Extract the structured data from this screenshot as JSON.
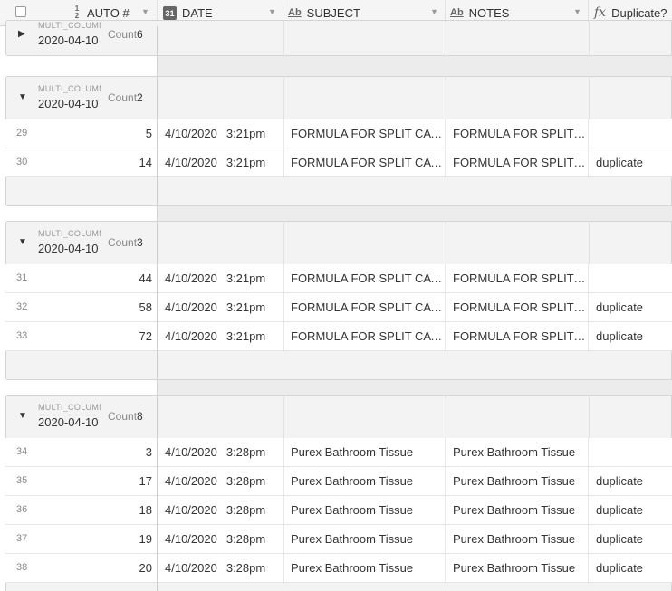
{
  "header": {
    "columns": [
      {
        "label": "AUTO #",
        "icon": "autonumber-icon"
      },
      {
        "label": "DATE",
        "icon": "date-icon"
      },
      {
        "label": "SUBJECT",
        "icon": "text-icon"
      },
      {
        "label": "NOTES",
        "icon": "text-icon"
      },
      {
        "label": "Duplicate?",
        "icon": "formula-icon"
      }
    ]
  },
  "groups": [
    {
      "field": "MULTI_COLUMN",
      "value": "2020-04-10",
      "count_label": "Count",
      "count": "6",
      "collapsed": true,
      "rows": []
    },
    {
      "field": "MULTI_COLUMN",
      "value": "2020-04-10",
      "count_label": "Count",
      "count": "2",
      "collapsed": false,
      "rows": [
        {
          "num": "29",
          "auto": "5",
          "date": "4/10/2020",
          "time": "3:21pm",
          "subject": "FORMULA FOR SPLIT CATALOG",
          "notes": "FORMULA FOR SPLIT CATALOG",
          "dup": ""
        },
        {
          "num": "30",
          "auto": "14",
          "date": "4/10/2020",
          "time": "3:21pm",
          "subject": "FORMULA FOR SPLIT CATALOG",
          "notes": "FORMULA FOR SPLIT CATALOG",
          "dup": "duplicate"
        }
      ]
    },
    {
      "field": "MULTI_COLUMN",
      "value": "2020-04-10",
      "count_label": "Count",
      "count": "3",
      "collapsed": false,
      "rows": [
        {
          "num": "31",
          "auto": "44",
          "date": "4/10/2020",
          "time": "3:21pm",
          "subject": "FORMULA FOR SPLIT CATALOG",
          "notes": "FORMULA FOR SPLIT CATALOG",
          "dup": ""
        },
        {
          "num": "32",
          "auto": "58",
          "date": "4/10/2020",
          "time": "3:21pm",
          "subject": "FORMULA FOR SPLIT CATALOG",
          "notes": "FORMULA FOR SPLIT CATALOG",
          "dup": "duplicate"
        },
        {
          "num": "33",
          "auto": "72",
          "date": "4/10/2020",
          "time": "3:21pm",
          "subject": "FORMULA FOR SPLIT CATALOG",
          "notes": "FORMULA FOR SPLIT CATALOG",
          "dup": "duplicate"
        }
      ]
    },
    {
      "field": "MULTI_COLUMN",
      "value": "2020-04-10",
      "count_label": "Count",
      "count": "8",
      "collapsed": false,
      "rows": [
        {
          "num": "34",
          "auto": "3",
          "date": "4/10/2020",
          "time": "3:28pm",
          "subject": "Purex Bathroom Tissue",
          "notes": "Purex Bathroom Tissue",
          "dup": ""
        },
        {
          "num": "35",
          "auto": "17",
          "date": "4/10/2020",
          "time": "3:28pm",
          "subject": "Purex Bathroom Tissue",
          "notes": "Purex Bathroom Tissue",
          "dup": "duplicate"
        },
        {
          "num": "36",
          "auto": "18",
          "date": "4/10/2020",
          "time": "3:28pm",
          "subject": "Purex Bathroom Tissue",
          "notes": "Purex Bathroom Tissue",
          "dup": "duplicate"
        },
        {
          "num": "37",
          "auto": "19",
          "date": "4/10/2020",
          "time": "3:28pm",
          "subject": "Purex Bathroom Tissue",
          "notes": "Purex Bathroom Tissue",
          "dup": "duplicate"
        },
        {
          "num": "38",
          "auto": "20",
          "date": "4/10/2020",
          "time": "3:28pm",
          "subject": "Purex Bathroom Tissue",
          "notes": "Purex Bathroom Tissue",
          "dup": "duplicate"
        }
      ]
    }
  ],
  "colors": {
    "header_bg": "#f5f5f5",
    "group_bg": "#f3f3f3",
    "border": "#d4d4d4",
    "text": "#333333",
    "muted": "#888888"
  }
}
